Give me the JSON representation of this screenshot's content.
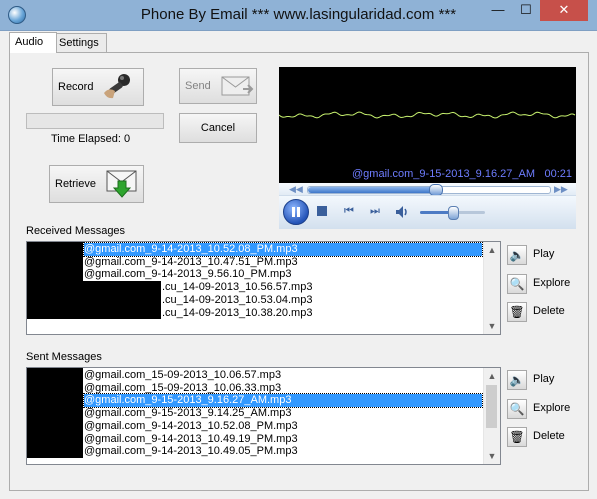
{
  "window": {
    "title": "Phone By Email *** www.lasingularidad.com  ***",
    "minimize": "—",
    "maximize": "☐",
    "close": "✕"
  },
  "tabs": [
    {
      "label": "Audio",
      "active": true
    },
    {
      "label": "Settings",
      "active": false
    }
  ],
  "audio": {
    "record_label": "Record",
    "send_label": "Send",
    "cancel_label": "Cancel",
    "retrieve_label": "Retrieve",
    "progress_value": 0,
    "time_elapsed_label": "Time Elapsed:",
    "time_elapsed_value": "0"
  },
  "player": {
    "file_label": "@gmail.com_9-15-2013_9.16.27_AM",
    "time": "00:21",
    "seek_position": 0.53,
    "volume_level": 0.5,
    "accent_color": "#6e7dff",
    "wave_color": "#c6f06e"
  },
  "received": {
    "label": "Received Messages",
    "items": [
      "@gmail.com_9-14-2013_10.52.08_PM.mp3",
      "@gmail.com_9-14-2013_10.47.51_PM.mp3",
      "@gmail.com_9-14-2013_9.56.10_PM.mp3",
      ".cu_14-09-2013_10.56.57.mp3",
      ".cu_14-09-2013_10.53.04.mp3",
      ".cu_14-09-2013_10.38.20.mp3"
    ],
    "selected_index": 0,
    "buttons": {
      "play": "Play",
      "explore": "Explore",
      "delete": "Delete"
    }
  },
  "sent": {
    "label": "Sent Messages",
    "items": [
      "@gmail.com_15-09-2013_10.06.57.mp3",
      "@gmail.com_15-09-2013_10.06.33.mp3",
      "@gmail.com_9-15-2013_9.16.27_AM.mp3",
      "@gmail.com_9-15-2013_9.14.25_AM.mp3",
      "@gmail.com_9-14-2013_10.52.08_PM.mp3",
      "@gmail.com_9-14-2013_10.49.19_PM.mp3",
      "@gmail.com_9-14-2013_10.49.05_PM.mp3"
    ],
    "selected_index": 2,
    "buttons": {
      "play": "Play",
      "explore": "Explore",
      "delete": "Delete"
    }
  },
  "icons": {
    "app": "globe-icon",
    "record": "microphone-icon",
    "send": "envelope-icon",
    "retrieve": "envelope-download-icon",
    "play": "speaker-icon",
    "explore": "folder-search-icon",
    "delete": "trash-icon"
  }
}
